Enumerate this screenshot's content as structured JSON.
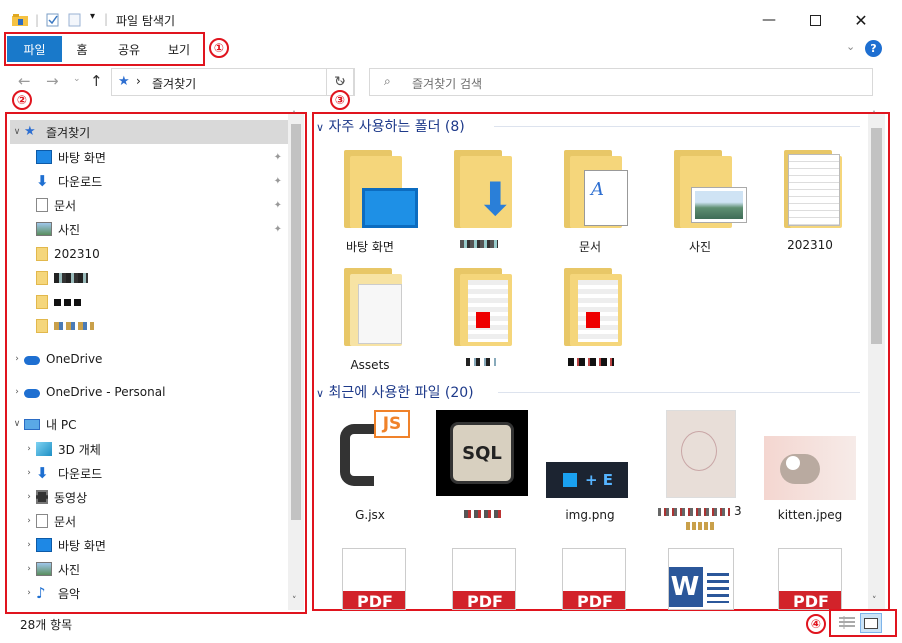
{
  "window": {
    "title": "파일 탐색기"
  },
  "ribbon": {
    "tabs": [
      "파일",
      "홈",
      "공유",
      "보기"
    ]
  },
  "callouts": [
    "①",
    "②",
    "③",
    "④"
  ],
  "address": {
    "location": "즐겨찾기",
    "separator": "›"
  },
  "search": {
    "placeholder": "즐겨찾기 검색"
  },
  "nav": {
    "favorites_label": "즐겨찾기",
    "pinned": [
      "바탕 화면",
      "다운로드",
      "문서",
      "사진"
    ],
    "recent_folder": "202310",
    "onedrive": "OneDrive",
    "onedrive_personal": "OneDrive - Personal",
    "thispc": "내 PC",
    "pc_items": [
      "3D 개체",
      "다운로드",
      "동영상",
      "문서",
      "바탕 화면",
      "사진",
      "음악"
    ]
  },
  "frequent": {
    "header": "자주 사용하는 폴더 (8)",
    "items": [
      "바탕 화면",
      "",
      "문서",
      "사진",
      "202310",
      "Assets",
      "",
      ""
    ]
  },
  "recent": {
    "header": "최근에 사용한 파일 (20)",
    "items": [
      "G.jsx",
      "",
      "img.png",
      "3",
      "kitten.jpeg"
    ],
    "thumb_texts": {
      "js": "JS",
      "sql": "SQL",
      "plus_e": "+ E",
      "pdf": "PDF",
      "word": "W"
    }
  },
  "status": {
    "count": "28개 항목"
  },
  "icons": [
    "home-icon",
    "checkbox-icon",
    "doc-icon",
    "dropdown-icon",
    "minimize-icon",
    "maximize-icon",
    "close-icon",
    "help-icon",
    "back-icon",
    "forward-icon",
    "up-icon",
    "refresh-icon",
    "search-icon",
    "star-icon",
    "pin-icon",
    "folder-icon",
    "cloud-icon",
    "pc-icon",
    "download-icon",
    "music-icon"
  ],
  "colors": {
    "accent": "#1979ca",
    "callout": "#e0141e",
    "folder": "#f5d67b",
    "pdf": "#d2232a",
    "word": "#2b579a"
  }
}
